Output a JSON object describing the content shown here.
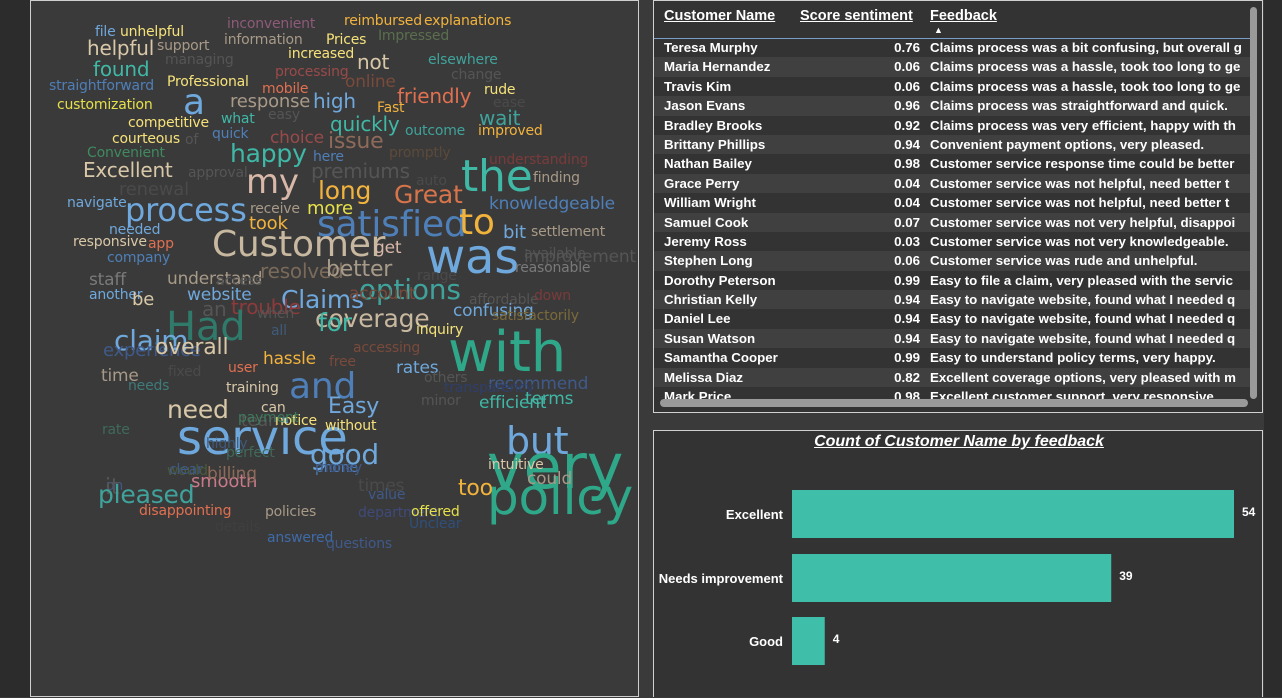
{
  "word_cloud": {
    "words": [
      {
        "text": "file",
        "color": "#6fa8dc",
        "size": 14
      },
      {
        "text": "unhelpful",
        "color": "#f6e27a",
        "size": 14
      },
      {
        "text": "inconvenient",
        "color": "#8e5a7a",
        "size": 14
      },
      {
        "text": "reimbursed",
        "color": "#f2b33d",
        "size": 14
      },
      {
        "text": "explanations",
        "color": "#f2b33d",
        "size": 14
      },
      {
        "text": "helpful",
        "color": "#d8c8a8",
        "size": 20
      },
      {
        "text": "support",
        "color": "#a89a88",
        "size": 14
      },
      {
        "text": "information",
        "color": "#a89a88",
        "size": 14
      },
      {
        "text": "Prices",
        "color": "#f6e27a",
        "size": 14
      },
      {
        "text": "Impressed",
        "color": "#5b6e4f",
        "size": 14
      },
      {
        "text": "managing",
        "color": "#555555",
        "size": 14
      },
      {
        "text": "increased",
        "color": "#f6e27a",
        "size": 14
      },
      {
        "text": "found",
        "color": "#3fb8a6",
        "size": 20
      },
      {
        "text": "not",
        "color": "#d8c8a8",
        "size": 20
      },
      {
        "text": "elsewhere",
        "color": "#3fa39b",
        "size": 14
      },
      {
        "text": "processing",
        "color": "#9a4a4a",
        "size": 14
      },
      {
        "text": "straightforward",
        "color": "#4f7fb8",
        "size": 14
      },
      {
        "text": "Professional",
        "color": "#f6e27a",
        "size": 14
      },
      {
        "text": "mobile",
        "color": "#e07050",
        "size": 14
      },
      {
        "text": "online",
        "color": "#7a4a3a",
        "size": 17
      },
      {
        "text": "change",
        "color": "#555555",
        "size": 14
      },
      {
        "text": "a",
        "color": "#6fa8dc",
        "size": 36
      },
      {
        "text": "friendly",
        "color": "#e07050",
        "size": 20
      },
      {
        "text": "rude",
        "color": "#f6e27a",
        "size": 14
      },
      {
        "text": "customization",
        "color": "#e6e04a",
        "size": 14
      },
      {
        "text": "response",
        "color": "#a89a88",
        "size": 18
      },
      {
        "text": "high",
        "color": "#6fa8dc",
        "size": 20
      },
      {
        "text": "Fast",
        "color": "#f2b33d",
        "size": 14
      },
      {
        "text": "ease",
        "color": "#4a4a4a",
        "size": 14
      },
      {
        "text": "competitive",
        "color": "#f6e27a",
        "size": 14
      },
      {
        "text": "what",
        "color": "#3fb8a6",
        "size": 14
      },
      {
        "text": "easy",
        "color": "#555555",
        "size": 14
      },
      {
        "text": "quickly",
        "color": "#3fb8a6",
        "size": 20
      },
      {
        "text": "wait",
        "color": "#3fa39b",
        "size": 20
      },
      {
        "text": "courteous",
        "color": "#f6e27a",
        "size": 14
      },
      {
        "text": "quick",
        "color": "#4f7fb8",
        "size": 14
      },
      {
        "text": "of",
        "color": "#555555",
        "size": 14
      },
      {
        "text": "choice",
        "color": "#9a4a4a",
        "size": 17
      },
      {
        "text": "issue",
        "color": "#8e6a5a",
        "size": 22
      },
      {
        "text": "outcome",
        "color": "#3fa39b",
        "size": 14
      },
      {
        "text": "improved",
        "color": "#f2b33d",
        "size": 14
      },
      {
        "text": "Convenient",
        "color": "#3f8a5f",
        "size": 14
      },
      {
        "text": "happy",
        "color": "#3fb8a6",
        "size": 25
      },
      {
        "text": "here",
        "color": "#4f7fb8",
        "size": 14
      },
      {
        "text": "promptly",
        "color": "#5b4a3a",
        "size": 14
      },
      {
        "text": "understanding",
        "color": "#7a3a3a",
        "size": 14
      },
      {
        "text": "Excellent",
        "color": "#d8c8a8",
        "size": 20
      },
      {
        "text": "approval",
        "color": "#555555",
        "size": 14
      },
      {
        "text": "my",
        "color": "#d8b8a8",
        "size": 34
      },
      {
        "text": "premiums",
        "color": "#555555",
        "size": 20
      },
      {
        "text": "auto",
        "color": "#4a4a4a",
        "size": 14
      },
      {
        "text": "the",
        "color": "#3fb8a6",
        "size": 44
      },
      {
        "text": "finding",
        "color": "#a89a88",
        "size": 14
      },
      {
        "text": "renewal",
        "color": "#4a4a4a",
        "size": 18
      },
      {
        "text": "long",
        "color": "#f2b33d",
        "size": 25
      },
      {
        "text": "Great",
        "color": "#d8744a",
        "size": 25
      },
      {
        "text": "navigate",
        "color": "#6fa8dc",
        "size": 14
      },
      {
        "text": "process",
        "color": "#6fa8dc",
        "size": 32
      },
      {
        "text": "receive",
        "color": "#a89a88",
        "size": 14
      },
      {
        "text": "more",
        "color": "#e6e04a",
        "size": 18
      },
      {
        "text": "knowledgeable",
        "color": "#4f7fb8",
        "size": 17
      },
      {
        "text": "needed",
        "color": "#6fa8dc",
        "size": 14
      },
      {
        "text": "took",
        "color": "#f2b33d",
        "size": 18
      },
      {
        "text": "satisfied",
        "color": "#4f7fb8",
        "size": 36
      },
      {
        "text": "to",
        "color": "#f2b33d",
        "size": 36
      },
      {
        "text": "bit",
        "color": "#6fa8dc",
        "size": 18
      },
      {
        "text": "settlement",
        "color": "#a89a88",
        "size": 14
      },
      {
        "text": "responsive",
        "color": "#d8c8a8",
        "size": 14
      },
      {
        "text": "app",
        "color": "#e07050",
        "size": 14
      },
      {
        "text": "Customer",
        "color": "#c8b8a0",
        "size": 36
      },
      {
        "text": "get",
        "color": "#d8b8a8",
        "size": 17
      },
      {
        "text": "was",
        "color": "#6fa8dc",
        "size": 48
      },
      {
        "text": "available",
        "color": "#555555",
        "size": 14
      },
      {
        "text": "improvement",
        "color": "#555555",
        "size": 17
      },
      {
        "text": "company",
        "color": "#4f7fb8",
        "size": 14
      },
      {
        "text": "resolved",
        "color": "#7a6a5a",
        "size": 20
      },
      {
        "text": "better",
        "color": "#a89a88",
        "size": 22
      },
      {
        "text": "reasonable",
        "color": "#7a7a7a",
        "size": 14
      },
      {
        "text": "staff",
        "color": "#7a7a7a",
        "size": 17
      },
      {
        "text": "understand",
        "color": "#a89a88",
        "size": 17
      },
      {
        "text": "access",
        "color": "#555555",
        "size": 14
      },
      {
        "text": "options",
        "color": "#3fa39b",
        "size": 28
      },
      {
        "text": "range",
        "color": "#4a4a4a",
        "size": 14
      },
      {
        "text": "another",
        "color": "#6fa8dc",
        "size": 14
      },
      {
        "text": "be",
        "color": "#d8c8a8",
        "size": 18
      },
      {
        "text": "website",
        "color": "#6fa8dc",
        "size": 17
      },
      {
        "text": "Claims",
        "color": "#6fa8dc",
        "size": 25
      },
      {
        "text": "account",
        "color": "#7a4a3a",
        "size": 17
      },
      {
        "text": "affordable",
        "color": "#555555",
        "size": 14
      },
      {
        "text": "down",
        "color": "#7a3a3a",
        "size": 14
      },
      {
        "text": "trouble",
        "color": "#8e3a3a",
        "size": 20
      },
      {
        "text": "Had",
        "color": "#2f7a6a",
        "size": 40
      },
      {
        "text": "an",
        "color": "#555555",
        "size": 20
      },
      {
        "text": "when",
        "color": "#555555",
        "size": 14
      },
      {
        "text": "coverage",
        "color": "#c8b8a0",
        "size": 25
      },
      {
        "text": "for",
        "color": "#3fb8a6",
        "size": 25
      },
      {
        "text": "confusing",
        "color": "#6fa8dc",
        "size": 17
      },
      {
        "text": "satisfactorily",
        "color": "#7a6a3a",
        "size": 14
      },
      {
        "text": "claim",
        "color": "#6fa8dc",
        "size": 28
      },
      {
        "text": "all",
        "color": "#3f5a7a",
        "size": 14
      },
      {
        "text": "with",
        "color": "#2fa88a",
        "size": 56
      },
      {
        "text": "inquiry",
        "color": "#f6e27a",
        "size": 14
      },
      {
        "text": "experience",
        "color": "#3f5a8a",
        "size": 18
      },
      {
        "text": "overall",
        "color": "#d8c8a8",
        "size": 22
      },
      {
        "text": "hassle",
        "color": "#f2b33d",
        "size": 17
      },
      {
        "text": "accessing",
        "color": "#7a4a3a",
        "size": 14
      },
      {
        "text": "time",
        "color": "#a89a88",
        "size": 17
      },
      {
        "text": "fixed",
        "color": "#4a4a4a",
        "size": 14
      },
      {
        "text": "user",
        "color": "#e07050",
        "size": 14
      },
      {
        "text": "and",
        "color": "#4f7fb8",
        "size": 36
      },
      {
        "text": "free",
        "color": "#7a4a3a",
        "size": 14
      },
      {
        "text": "rates",
        "color": "#6fa8dc",
        "size": 17
      },
      {
        "text": "others",
        "color": "#555555",
        "size": 14
      },
      {
        "text": "recommend",
        "color": "#3f5a8a",
        "size": 17
      },
      {
        "text": "needs",
        "color": "#3f7a7a",
        "size": 14
      },
      {
        "text": "transparency",
        "color": "#2f3f6a",
        "size": 14
      },
      {
        "text": "terms",
        "color": "#3fb8a6",
        "size": 17
      },
      {
        "text": "need",
        "color": "#d8c8a8",
        "size": 25
      },
      {
        "text": "training",
        "color": "#d8c8a8",
        "size": 14
      },
      {
        "text": "minor",
        "color": "#555555",
        "size": 14
      },
      {
        "text": "efficient",
        "color": "#3fb8a6",
        "size": 17
      },
      {
        "text": "can",
        "color": "#d8c8a8",
        "size": 14
      },
      {
        "text": "service",
        "color": "#6fa8dc",
        "size": 48
      },
      {
        "text": "team",
        "color": "#555555",
        "size": 17
      },
      {
        "text": "notice",
        "color": "#f6e27a",
        "size": 14
      },
      {
        "text": "Easy",
        "color": "#6fa8dc",
        "size": 22
      },
      {
        "text": "but",
        "color": "#6fa8dc",
        "size": 38
      },
      {
        "text": "payment",
        "color": "#3f7a5f",
        "size": 14
      },
      {
        "text": "rate",
        "color": "#3f6a5a",
        "size": 14
      },
      {
        "text": "highly",
        "color": "#3f5a7a",
        "size": 14
      },
      {
        "text": "good",
        "color": "#6fa8dc",
        "size": 28
      },
      {
        "text": "very",
        "color": "#2fa88a",
        "size": 62
      },
      {
        "text": "perfect",
        "color": "#3f6a5a",
        "size": 14
      },
      {
        "text": "without",
        "color": "#f6e27a",
        "size": 14
      },
      {
        "text": "on",
        "color": "#3f5a8a",
        "size": 14
      },
      {
        "text": "would",
        "color": "#4a5a3a",
        "size": 14
      },
      {
        "text": "phone",
        "color": "#4f7fb8",
        "size": 14
      },
      {
        "text": "intuitive",
        "color": "#d8c8a8",
        "size": 14
      },
      {
        "text": "it",
        "color": "#555555",
        "size": 22
      },
      {
        "text": "clear",
        "color": "#3f5a8a",
        "size": 14
      },
      {
        "text": "money",
        "color": "#3f5a8a",
        "size": 14
      },
      {
        "text": "policy",
        "color": "#2fa88a",
        "size": 50
      },
      {
        "text": "could",
        "color": "#a89a88",
        "size": 17
      },
      {
        "text": "pleased",
        "color": "#3fa39b",
        "size": 25
      },
      {
        "text": "smooth",
        "color": "#c87a8a",
        "size": 18
      },
      {
        "text": "times",
        "color": "#4a4a4a",
        "size": 17
      },
      {
        "text": "too",
        "color": "#f2b33d",
        "size": 22
      },
      {
        "text": "billing",
        "color": "#8e6a5a",
        "size": 17
      },
      {
        "text": "value",
        "color": "#3f5a8a",
        "size": 14
      },
      {
        "text": "disappointing",
        "color": "#e07050",
        "size": 14
      },
      {
        "text": "details",
        "color": "#3f3f3f",
        "size": 14
      },
      {
        "text": "policies",
        "color": "#a89a88",
        "size": 14
      },
      {
        "text": "department",
        "color": "#3f4a7a",
        "size": 14
      },
      {
        "text": "offered",
        "color": "#e6e04a",
        "size": 14
      },
      {
        "text": "Unclear",
        "color": "#2f4f7a",
        "size": 14
      },
      {
        "text": "answered",
        "color": "#3f6aa8",
        "size": 14
      },
      {
        "text": "questions",
        "color": "#3f5a8a",
        "size": 14
      }
    ]
  },
  "table": {
    "headers": {
      "name": "Customer Name",
      "score": "Score sentiment",
      "feedback": "Feedback"
    },
    "rows": [
      {
        "name": "Teresa Murphy",
        "score": "0.76",
        "feedback": "Claims process was a bit confusing, but overall g"
      },
      {
        "name": "Maria Hernandez",
        "score": "0.06",
        "feedback": "Claims process was a hassle, took too long to ge"
      },
      {
        "name": "Travis Kim",
        "score": "0.06",
        "feedback": "Claims process was a hassle, took too long to ge"
      },
      {
        "name": "Jason Evans",
        "score": "0.96",
        "feedback": "Claims process was straightforward and quick."
      },
      {
        "name": "Bradley Brooks",
        "score": "0.92",
        "feedback": "Claims process was very efficient, happy with th"
      },
      {
        "name": "Brittany Phillips",
        "score": "0.94",
        "feedback": "Convenient payment options, very pleased."
      },
      {
        "name": "Nathan Bailey",
        "score": "0.98",
        "feedback": "Customer service response time could be better"
      },
      {
        "name": "Grace Perry",
        "score": "0.04",
        "feedback": "Customer service was not helpful, need better t"
      },
      {
        "name": "William Wright",
        "score": "0.04",
        "feedback": "Customer service was not helpful, need better t"
      },
      {
        "name": "Samuel Cook",
        "score": "0.07",
        "feedback": "Customer service was not very helpful, disappoi"
      },
      {
        "name": "Jeremy Ross",
        "score": "0.03",
        "feedback": "Customer service was not very knowledgeable."
      },
      {
        "name": "Stephen Long",
        "score": "0.06",
        "feedback": "Customer service was rude and unhelpful."
      },
      {
        "name": "Dorothy Peterson",
        "score": "0.99",
        "feedback": "Easy to file a claim, very pleased with the servic"
      },
      {
        "name": "Christian Kelly",
        "score": "0.94",
        "feedback": "Easy to navigate website, found what I needed q"
      },
      {
        "name": "Daniel Lee",
        "score": "0.94",
        "feedback": "Easy to navigate website, found what I needed q"
      },
      {
        "name": "Susan Watson",
        "score": "0.94",
        "feedback": "Easy to navigate website, found what I needed q"
      },
      {
        "name": "Samantha Cooper",
        "score": "0.99",
        "feedback": "Easy to understand policy terms, very happy."
      },
      {
        "name": "Melissa Diaz",
        "score": "0.82",
        "feedback": "Excellent coverage options, very pleased with m"
      },
      {
        "name": "Mark Price",
        "score": "0.98",
        "feedback": "Excellent customer support, very responsive."
      }
    ]
  },
  "bar_chart": {
    "bar_color": "#3fbfaa"
  },
  "chart_data": {
    "type": "bar",
    "orientation": "horizontal",
    "title": "Count of Customer Name by feedback",
    "categories": [
      "Excellent",
      "Needs improvement",
      "Good"
    ],
    "values": [
      54,
      39,
      4
    ],
    "xlim": [
      0,
      54
    ],
    "grid": false,
    "legend": "none"
  }
}
